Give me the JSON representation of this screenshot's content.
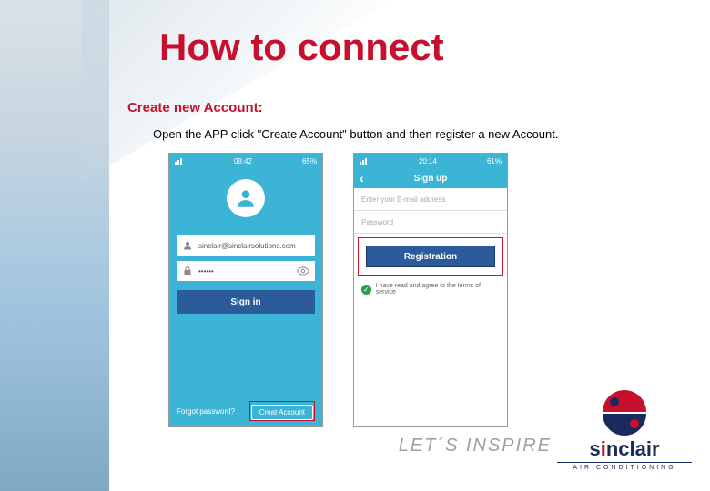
{
  "title": "How to connect",
  "subtitle": "Create new Account:",
  "instruction": "Open the APP click \"Create Account\" button and then register a new Account.",
  "phone1": {
    "status": {
      "time": "09:42",
      "battery": "65%"
    },
    "email": "sinclair@sinclairsolutions.com",
    "password_mask": "••••••",
    "signin_label": "Sign in",
    "forgot_label": "Forgot password?",
    "create_label": "Creat Account"
  },
  "phone2": {
    "status": {
      "time": "20:14",
      "battery": "61%"
    },
    "header": "Sign up",
    "email_placeholder": "Enter your E-mail address",
    "password_placeholder": "Password",
    "register_label": "Registration",
    "terms_label": "I have read and agree to the terms of service"
  },
  "tagline": "LET´S INSPIRE",
  "brand": {
    "name_pre": "s",
    "name_i": "i",
    "name_post": "nclair",
    "sub": "AIR CONDITIONING"
  }
}
